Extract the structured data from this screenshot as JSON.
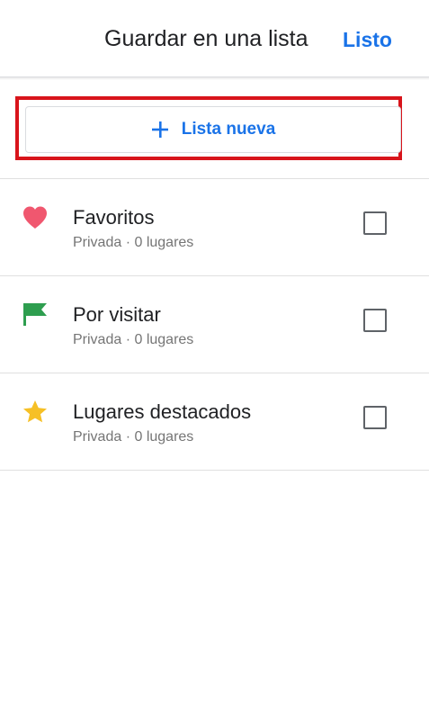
{
  "header": {
    "title": "Guardar en una lista",
    "done_label": "Listo"
  },
  "new_list": {
    "label": "Lista nueva",
    "icon": "plus-icon"
  },
  "lists": [
    {
      "name": "Favoritos",
      "subtitle": "Privada · 0 lugares",
      "icon": "heart-icon",
      "icon_color": "#f0576f",
      "checked": false
    },
    {
      "name": "Por visitar",
      "subtitle": "Privada · 0 lugares",
      "icon": "flag-icon",
      "icon_color": "#2e9e4f",
      "checked": false
    },
    {
      "name": "Lugares destacados",
      "subtitle": "Privada · 0 lugares",
      "icon": "star-icon",
      "icon_color": "#f6c026",
      "checked": false
    }
  ],
  "colors": {
    "accent": "#1a73e8",
    "highlight": "#d8141b"
  }
}
